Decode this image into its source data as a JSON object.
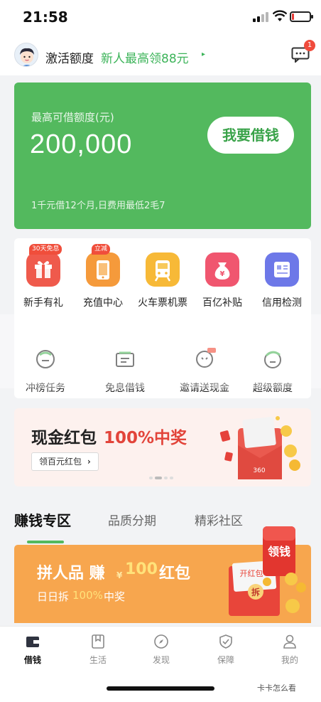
{
  "status_bar": {
    "time": "21:58",
    "battery_level": 0.12,
    "signal_bars": 2
  },
  "header": {
    "activate_label": "激活额度",
    "promo_text": "新人最高领88元",
    "promo_arrow": "▸",
    "message_badge": "1"
  },
  "loan_card": {
    "label": "最高可借额度(元)",
    "amount": "200,000",
    "borrow_button": "我要借钱",
    "note": "1千元借12个月,日费用最低2毛7",
    "bg_color": "#53b95e"
  },
  "services_row1": [
    {
      "label": "新手有礼",
      "tag": "30天免息",
      "icon": "gift-icon",
      "color": "#ef5a4c"
    },
    {
      "label": "充值中心",
      "tag": "立减",
      "icon": "phone-icon",
      "color": "#f59a3b"
    },
    {
      "label": "火车票机票",
      "tag": "",
      "icon": "train-icon",
      "color": "#f7b937"
    },
    {
      "label": "百亿补贴",
      "tag": "",
      "icon": "money-bag-icon",
      "color": "#f0566f"
    },
    {
      "label": "信用检测",
      "tag": "",
      "icon": "report-icon",
      "color": "#6d78e8"
    }
  ],
  "services_row2": [
    {
      "label": "冲榜任务",
      "icon": "ranking-icon"
    },
    {
      "label": "免息借钱",
      "icon": "coupon-icon"
    },
    {
      "label": "邀请送现金",
      "icon": "invite-icon"
    },
    {
      "label": "超级额度",
      "icon": "super-quota-icon"
    }
  ],
  "red_packet": {
    "title": "现金红包",
    "highlight": "100%中奖",
    "button": "领百元红包",
    "button_arrow": "›",
    "art_text": "360"
  },
  "section_tabs": [
    "赚钱专区",
    "品质分期",
    "精彩社区"
  ],
  "promo_banner": {
    "title": "拼人品 赚",
    "yen": "¥",
    "amount": "100",
    "title_tail": "红包",
    "sub_prefix": "日日拆",
    "sub_highlight": "100%",
    "sub_suffix": "中奖",
    "art_label": "开红包",
    "art_button": "拆",
    "badge": "领钱"
  },
  "bottom_nav": [
    {
      "label": "借钱",
      "icon": "wallet-icon",
      "active": true
    },
    {
      "label": "生活",
      "icon": "bookmark-icon",
      "active": false
    },
    {
      "label": "发现",
      "icon": "compass-icon",
      "active": false
    },
    {
      "label": "保障",
      "icon": "shield-icon",
      "active": false
    },
    {
      "label": "我的",
      "icon": "user-icon",
      "active": false
    }
  ],
  "watermark": "卡卡怎么看"
}
